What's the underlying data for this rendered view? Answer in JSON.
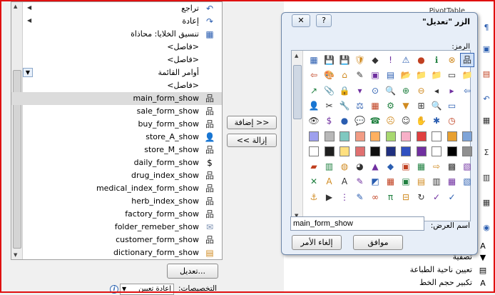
{
  "left_list": {
    "items": [
      {
        "label": "تراجع",
        "icon": "undo-arrow-icon",
        "glyph": "↶",
        "arrow": true
      },
      {
        "label": "إعادة",
        "icon": "redo-arrow-icon",
        "glyph": "↷",
        "arrow": true
      },
      {
        "label": "تنسيق الخلايا: محاذاة",
        "icon": "cell-alignment-icon",
        "glyph": "▦"
      },
      {
        "label": "<فاصل>",
        "icon": "",
        "glyph": ""
      },
      {
        "label": "<فاصل>",
        "icon": "",
        "glyph": ""
      },
      {
        "label": "أوامر القائمة",
        "icon": "",
        "glyph": "",
        "dropdown": true
      },
      {
        "label": "<فاصل>",
        "icon": "",
        "glyph": ""
      },
      {
        "label": "main_form_show",
        "icon": "hierarchy-icon",
        "glyph": "品",
        "selected": true
      },
      {
        "label": "sale_form_show",
        "icon": "hierarchy-icon",
        "glyph": "品"
      },
      {
        "label": "buy_form_show",
        "icon": "hierarchy-icon",
        "glyph": "品"
      },
      {
        "label": "store_A_show",
        "icon": "person-icon",
        "glyph": "👤"
      },
      {
        "label": "store_M_show",
        "icon": "hierarchy-icon",
        "glyph": "品"
      },
      {
        "label": "daily_form_show",
        "icon": "dollar-icon",
        "glyph": "$"
      },
      {
        "label": "drug_index_show",
        "icon": "hierarchy-icon",
        "glyph": "品"
      },
      {
        "label": "medical_index_form_show",
        "icon": "hierarchy-icon",
        "glyph": "品"
      },
      {
        "label": "herb_index_show",
        "icon": "hierarchy-icon",
        "glyph": "品"
      },
      {
        "label": "factory_form_show",
        "icon": "hierarchy-icon",
        "glyph": "品"
      },
      {
        "label": "folder_remeber_show",
        "icon": "envelope-icon",
        "glyph": "✉"
      },
      {
        "label": "customer_form_show",
        "icon": "hierarchy-icon",
        "glyph": "品"
      },
      {
        "label": "dictionary_form_show",
        "icon": "box-icon",
        "glyph": "▤"
      }
    ],
    "modify_button": "تعديل...",
    "add_button": "إضافة >>",
    "remove_button": "<< إزالة",
    "customizations_label": "التخصيصات:",
    "reset_combo": "إعادة تعيين"
  },
  "dialog": {
    "title": "الزر \"تعديل\"",
    "close_glyph": "✕",
    "help_glyph": "?",
    "symbol_label": "الرمز:",
    "display_name_label": "اسم العرض:",
    "display_name_value": "main_form_show",
    "ok_button": "موافق",
    "cancel_button": "إلغاء الأمر",
    "symbols": [
      [
        "▦",
        "💾",
        "💾",
        "🛡",
        "◆",
        "!",
        "⚠",
        "●",
        "ℹ",
        "⊗",
        "品"
      ],
      [
        "⇦",
        "🎨",
        "⌂",
        "✎",
        "▣",
        "▤",
        "📂",
        "📁",
        "📁",
        "▭",
        "📁"
      ],
      [
        "↗",
        "📎",
        "🔒",
        "▾",
        "⊙",
        "🔍",
        "⊕",
        "⊖",
        "◂",
        "▸",
        "⇦"
      ],
      [
        "👤",
        "✂",
        "🔧",
        "⚖",
        "▦",
        "⚙",
        "▼",
        "⊞",
        "🔍",
        "▭"
      ],
      [
        "👁",
        "$",
        "●",
        "💬",
        "☎",
        "☹",
        "☺",
        "✋",
        "✱",
        "◷"
      ],
      [
        "■",
        "■",
        "■",
        "■",
        "■",
        "■",
        "■",
        "■",
        "■",
        "■",
        "■"
      ],
      [
        "□",
        "■",
        "■",
        "■",
        "■",
        "■",
        "■",
        "■",
        "■",
        "■",
        "■"
      ],
      [
        "▰",
        "▥",
        "◍",
        "◕",
        "▲",
        "◆",
        "▣",
        "▦",
        "⇨",
        "▩",
        "▧"
      ],
      [
        "✕",
        "A",
        "A",
        "✎",
        "◩",
        "▦",
        "▣",
        "▤",
        "▥",
        "▦",
        "▧"
      ],
      [
        "⚓",
        "▶",
        "⋮",
        "✎",
        "∞",
        "π",
        "⊟",
        "↻",
        "✓",
        "✓"
      ]
    ],
    "symbol_icons": [
      [
        "grid-icon",
        "save-icon",
        "save-icon",
        "shield-icon",
        "warning-diamond-icon",
        "exclamation-icon",
        "warning-triangle-icon",
        "blue-circle-icon",
        "info-icon",
        "error-icon",
        "hierarchy-icon"
      ],
      [
        "back-arrow-icon",
        "palette-icon",
        "home-icon",
        "edit-icon",
        "picture-icon",
        "list-icon",
        "open-folder-icon",
        "folder-icon",
        "folder-icon",
        "page-icon",
        "folder-icon"
      ],
      [
        "pencil-icon",
        "clip-icon",
        "lock-icon",
        "dropdown-icon",
        "circle-icon",
        "search-icon",
        "plus-circle-icon",
        "minus-circle-icon",
        "left-icon",
        "right-icon",
        "back-icon"
      ],
      [
        "person-icon",
        "scissors-icon",
        "wrench-icon",
        "balance-icon",
        "table-icon",
        "gear-icon",
        "filter-icon",
        "grid-plus-icon",
        "magnifier-icon",
        "window-icon"
      ],
      [
        "eye-icon",
        "dollar-icon",
        "ball-icon",
        "speech-icon",
        "phone-icon",
        "sad-face-icon",
        "smile-icon",
        "hand-icon",
        "asterisk-icon",
        "clock-icon"
      ],
      [
        "swatch-lavender-icon",
        "swatch-gray-icon",
        "swatch-teal-icon",
        "swatch-salmon-icon",
        "swatch-orange-icon",
        "swatch-green-icon",
        "swatch-pink-icon",
        "swatch-red-icon",
        "swatch-white-icon",
        "swatch-mosaic-icon",
        "swatch-blue-icon"
      ],
      [
        "swatch-empty-icon",
        "swatch-black-icon",
        "swatch-yellow-icon",
        "swatch-stripes-icon",
        "swatch-black2-icon",
        "swatch-darkblue-icon",
        "swatch-blue2-icon",
        "swatch-purple-icon",
        "swatch-white2-icon",
        "swatch-checker-icon",
        "swatch-gray2-icon"
      ],
      [
        "layers-icon",
        "cylinder-icon",
        "donut-icon",
        "pie-icon",
        "chart-icon",
        "drop-icon",
        "cube-icon",
        "grid-icon",
        "arrow-right-icon",
        "checker-icon",
        "pattern-icon"
      ],
      [
        "x-icon",
        "text-a-icon",
        "text-a2-icon",
        "brush-icon",
        "gradient-icon",
        "photo-icon",
        "image-icon",
        "landscape-icon",
        "tile-icon",
        "frame-icon",
        "frame2-icon"
      ],
      [
        "anchor-icon",
        "play-icon",
        "list-dots-icon",
        "pen-icon",
        "binoculars-icon",
        "pi-icon",
        "matrix-icon",
        "refresh-icon",
        "checkmark-icon",
        "check-icon"
      ]
    ],
    "swatch_colors": {
      "r5": [
        "#9ea0ee",
        "#b8b8b8",
        "#7fc8c0",
        "#f29c84",
        "#ffb060",
        "#a8d870",
        "#f7b0c8",
        "#e04040",
        "#ffffff",
        "#e8a030",
        "#7ea4d8"
      ],
      "r6": [
        "#ffffff",
        "#202020",
        "#ffe080",
        "#e07070",
        "#101010",
        "#203080",
        "#3050c0",
        "#7030a0",
        "#ffffff",
        "#000000",
        "#909090"
      ]
    }
  },
  "right_items": [
    {
      "label": "تصغير حجم الخط",
      "icon": "font-shrink-icon",
      "glyph": "A"
    },
    {
      "label": "تصفية",
      "icon": "filter-icon",
      "glyph": "▼"
    },
    {
      "label": "تعيين ناحية الطباعة",
      "icon": "print-area-icon",
      "glyph": "▤"
    },
    {
      "label": "تكبير حجم الخط",
      "icon": "font-grow-icon",
      "glyph": "A"
    }
  ],
  "right_header_fragment": "PivotTable"
}
